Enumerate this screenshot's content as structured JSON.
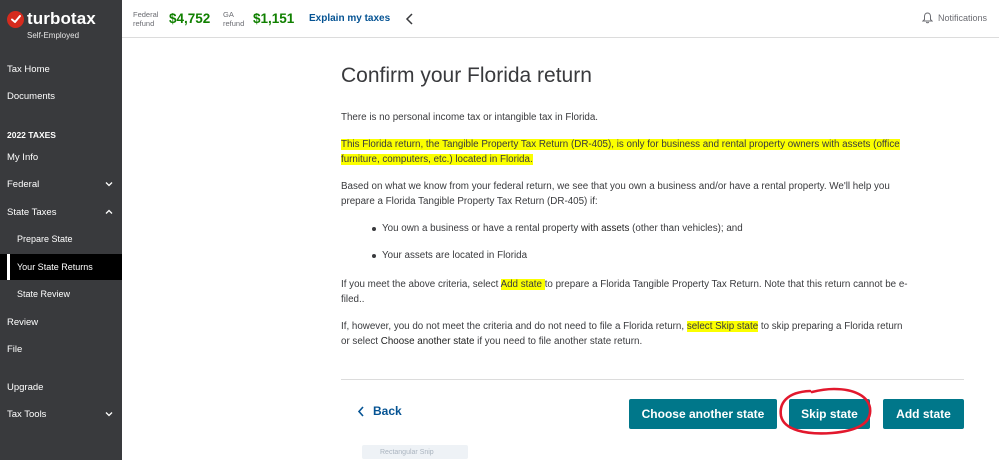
{
  "brand": {
    "name": "turbotax",
    "edition": "Self-Employed"
  },
  "sidebar": {
    "top_items": [
      {
        "label": "Tax Home"
      },
      {
        "label": "Documents"
      }
    ],
    "section_heading": "2022 TAXES",
    "items": [
      {
        "label": "My Info"
      },
      {
        "label": "Federal"
      },
      {
        "label": "State Taxes"
      },
      {
        "label": "Prepare State"
      },
      {
        "label": "Your State Returns"
      },
      {
        "label": "State Review"
      },
      {
        "label": "Review"
      },
      {
        "label": "File"
      },
      {
        "label": "Upgrade"
      },
      {
        "label": "Tax Tools"
      }
    ]
  },
  "header": {
    "federal_label": "Federal\nrefund",
    "federal_label_1": "Federal",
    "federal_label_2": "refund",
    "federal_amount": "$4,752",
    "state_label_1": "GA",
    "state_label_2": "refund",
    "state_amount": "$1,151",
    "explain": "Explain my taxes",
    "notifications": "Notifications"
  },
  "main": {
    "title": "Confirm your Florida return",
    "p1": "There is no personal income tax or intangible tax in Florida.",
    "p2": "This Florida return, the Tangible Property Tax Return (DR-405), is only for business and rental property owners with assets (office furniture, computers, etc.) located in Florida.",
    "p3": "Based on what we know from your federal return, we see that you own a business and/or have a rental property. We'll help you prepare a Florida Tangible Property Tax Return (DR-405) if:",
    "bullet1_a": "You own a business or have a rental property ",
    "bullet1_b": "with assets",
    "bullet1_c": " (other than vehicles); and",
    "bullet2": "Your assets are located in Florida",
    "p4_a": "If you meet the above criteria, select ",
    "p4_hl": "Add state ",
    "p4_b": "to prepare a Florida Tangible Property Tax Return. Note that this return cannot be e-filed..",
    "p5_a": "If, however, you do not meet the criteria and do not need to file a Florida return, ",
    "p5_hl": "select Skip state",
    "p5_b": " to skip preparing a Florida return or select ",
    "p5_c": "Choose another state",
    "p5_d": " if you need to file another state return."
  },
  "actions": {
    "back": "Back",
    "choose": "Choose another state",
    "skip": "Skip state",
    "add": "Add state"
  },
  "ghost_text": "Rectangular Snip",
  "colors": {
    "accent": "#00778a",
    "refund": "#108000",
    "link": "#055393",
    "highlight": "#fbff00",
    "sidebar": "#393a3d"
  }
}
